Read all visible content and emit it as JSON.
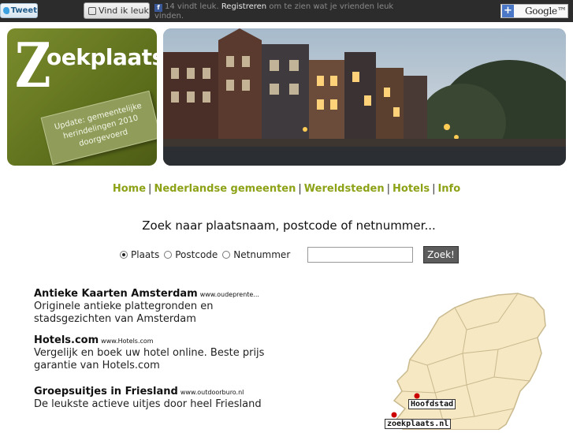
{
  "topbar": {
    "tweet_label": "Tweet",
    "like_label": "Vind ik leuk",
    "fb_count_text": "14 vindt leuk.",
    "fb_register": "Registreren",
    "fb_rest": "om te zien wat je vrienden leuk vinden.",
    "google_label": "Google™"
  },
  "logo": {
    "letter": "Z",
    "word": "oekplaats",
    "update_text": "Update: gemeentelijke herindelingen 2010 doorgevoerd"
  },
  "nav": {
    "items": [
      "Home",
      "Nederlandse gemeenten",
      "Wereldsteden",
      "Hotels",
      "Info"
    ],
    "separator": "|"
  },
  "search": {
    "title": "Zoek naar plaatsnaam, postcode of netnummer...",
    "options": [
      "Plaats",
      "Postcode",
      "Netnummer"
    ],
    "selected": "Plaats",
    "input_value": "",
    "button_label": "Zoek!"
  },
  "ads": [
    {
      "title": "Antieke Kaarten Amsterdam",
      "url": "www.oudeprente...",
      "text": "Originele antieke plattegronden en stadsgezichten van Amsterdam"
    },
    {
      "title": "Hotels.com",
      "url": "www.Hotels.com",
      "text": "Vergelijk en boek uw hotel online. Beste prijs garantie van Hotels.com"
    },
    {
      "title": "Groepsuitjes in Friesland",
      "url": "www.outdoorburo.nl",
      "text": "De leukste actieve uitjes door heel Friesland"
    }
  ],
  "map": {
    "label_capital": "Hoofdstad",
    "label_site": "zoekplaats.nl",
    "fill_color": "#f7e8c4",
    "border_color": "#c9b98e",
    "marker_color": "#cc0000"
  },
  "colors": {
    "accent": "#8da217",
    "topbar": "#2c2c2c",
    "logo_green": "#6b7c22"
  }
}
